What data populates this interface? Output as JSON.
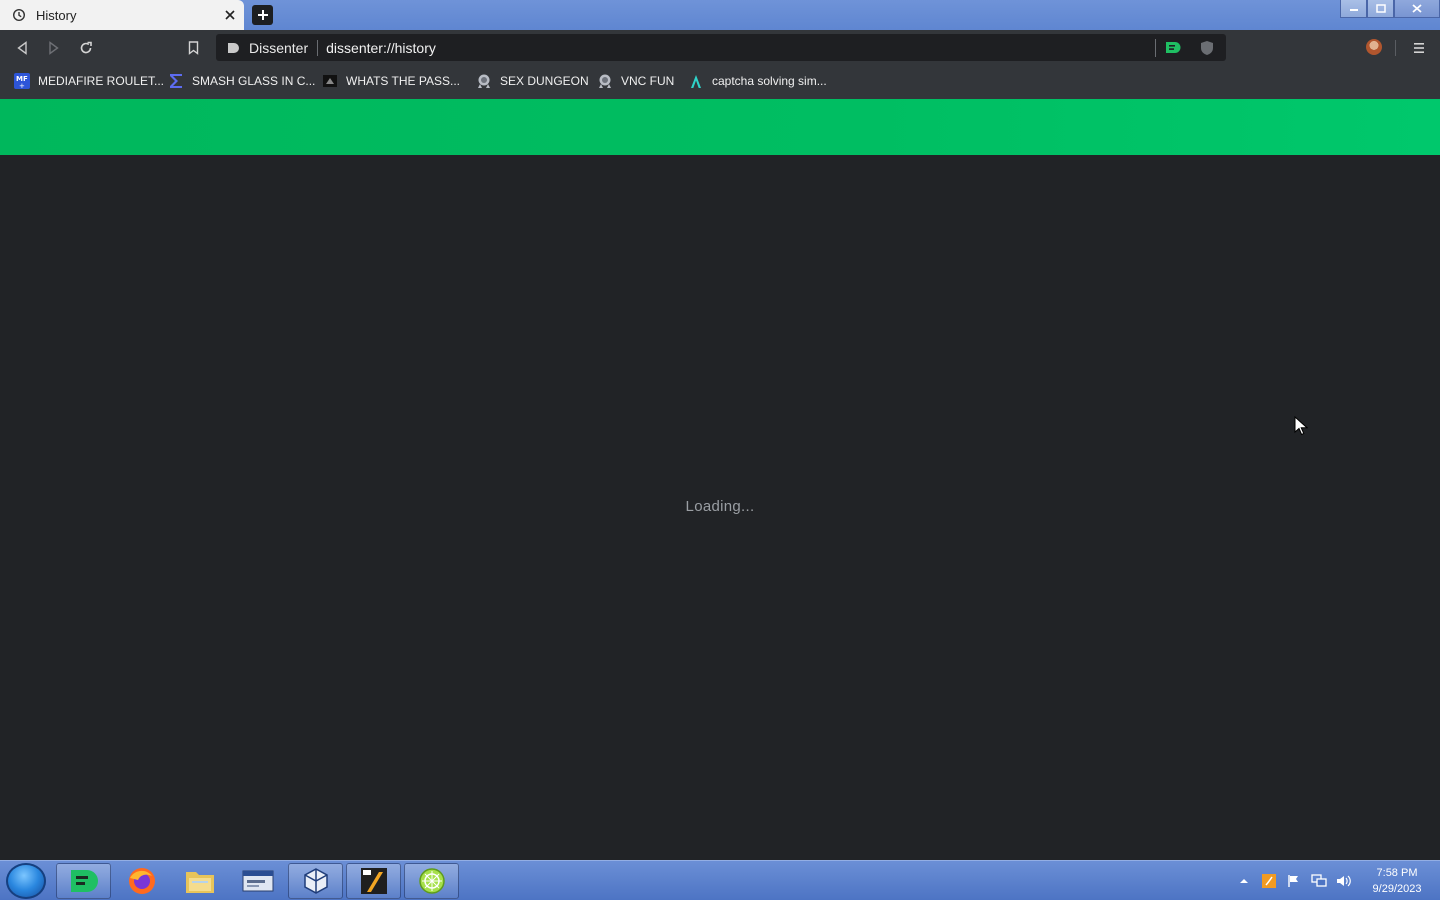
{
  "window": {
    "tab": {
      "title": "History"
    }
  },
  "toolbar": {
    "site_name": "Dissenter",
    "url": "dissenter://history"
  },
  "bookmarks": [
    {
      "label": "MEDIAFIRE ROULET...",
      "icon": "mediafire-icon"
    },
    {
      "label": "SMASH GLASS IN C...",
      "icon": "sigma-icon"
    },
    {
      "label": "WHATS THE PASS...",
      "icon": "site-icon"
    },
    {
      "label": "SEX DUNGEON",
      "icon": "badge-icon"
    },
    {
      "label": "VNC FUN",
      "icon": "badge-icon"
    },
    {
      "label": "captcha solving sim...",
      "icon": "lambda-icon"
    }
  ],
  "page": {
    "loading_text": "Loading...",
    "header_color": "#00c064",
    "background_color": "#212326"
  },
  "taskbar": {
    "apps": [
      "start-orb",
      "dissenter",
      "firefox",
      "file-explorer",
      "window-manager",
      "virtualbox",
      "fl-studio",
      "lime-app"
    ],
    "clock": {
      "time": "7:58 PM",
      "date": "9/29/2023"
    }
  }
}
